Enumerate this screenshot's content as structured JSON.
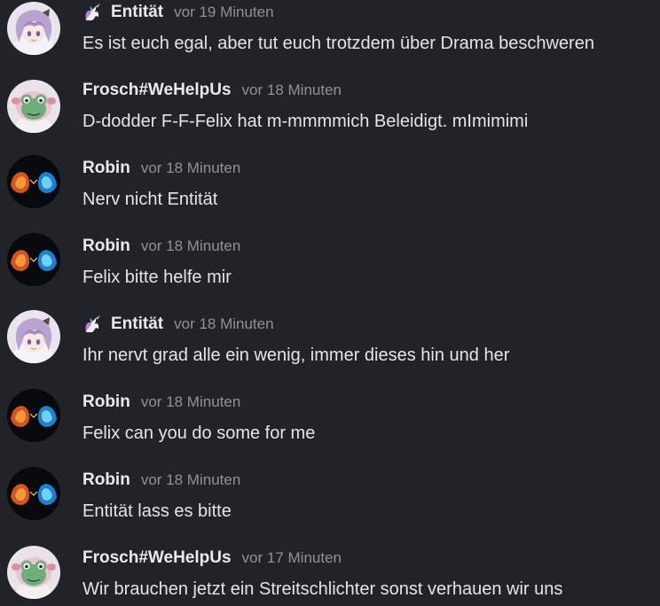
{
  "messages": [
    {
      "author": "Entität",
      "badge": "unicorn-icon",
      "avatar": "anime",
      "time": "vor 19 Minuten",
      "text": "Es ist euch egal, aber tut euch trotzdem über Drama beschweren"
    },
    {
      "author": "Frosch#WeHelpUs",
      "badge": null,
      "avatar": "frog",
      "time": "vor 18 Minuten",
      "text": "D-dodder F-F-Felix hat m-mmmmich Beleidigt. mImimimi"
    },
    {
      "author": "Robin",
      "badge": null,
      "avatar": "fire-ice",
      "time": "vor 18 Minuten",
      "text": "Nerv nicht Entität"
    },
    {
      "author": "Robin",
      "badge": null,
      "avatar": "fire-ice",
      "time": "vor 18 Minuten",
      "text": "Felix bitte helfe mir"
    },
    {
      "author": "Entität",
      "badge": "unicorn-icon",
      "avatar": "anime",
      "time": "vor 18 Minuten",
      "text": "Ihr nervt grad alle ein wenig, immer dieses hin und her"
    },
    {
      "author": "Robin",
      "badge": null,
      "avatar": "fire-ice",
      "time": "vor 18 Minuten",
      "text": "Felix can you do some for me"
    },
    {
      "author": "Robin",
      "badge": null,
      "avatar": "fire-ice",
      "time": "vor 18 Minuten",
      "text": "Entität lass es bitte"
    },
    {
      "author": "Frosch#WeHelpUs",
      "badge": null,
      "avatar": "frog",
      "time": "vor 17 Minuten",
      "text": "Wir brauchen jetzt ein Streitschlichter sonst verhauen wir uns"
    }
  ],
  "colors": {
    "background": "#222328",
    "username": "#eaeaed",
    "timestamp": "#8f9299",
    "text": "#e4e5e8"
  }
}
